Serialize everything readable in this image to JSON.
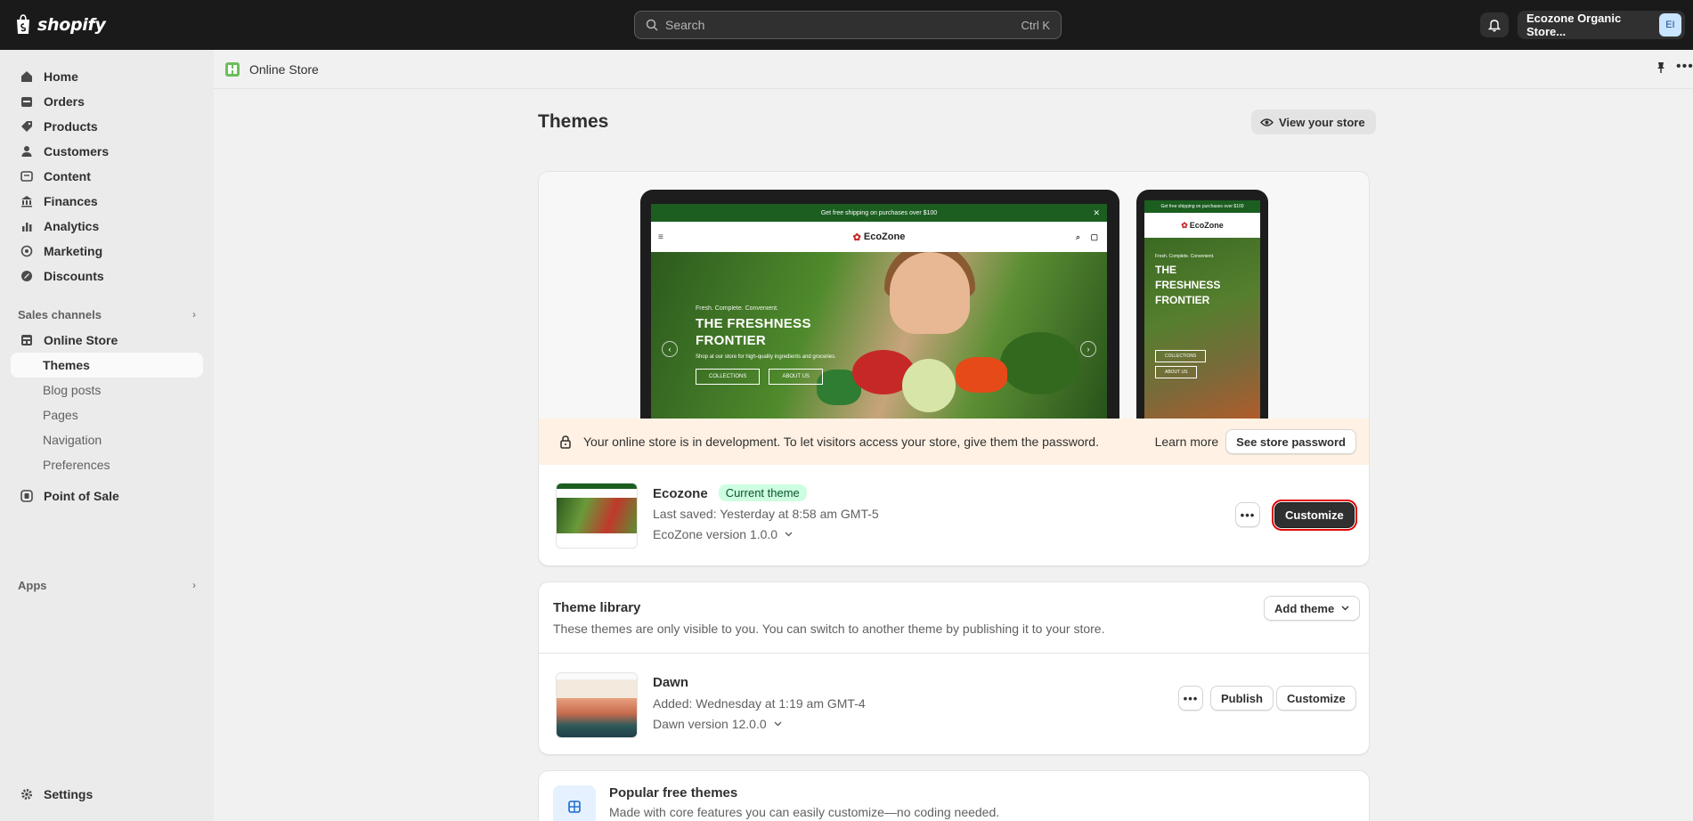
{
  "topbar": {
    "brand": "shopify",
    "search_placeholder": "Search",
    "search_shortcut": "Ctrl K",
    "store_name": "Ecozone Organic Store...",
    "store_initials": "EI"
  },
  "sidebar": {
    "items": [
      {
        "label": "Home",
        "icon": "home-icon"
      },
      {
        "label": "Orders",
        "icon": "orders-icon"
      },
      {
        "label": "Products",
        "icon": "tag-icon"
      },
      {
        "label": "Customers",
        "icon": "person-icon"
      },
      {
        "label": "Content",
        "icon": "content-icon"
      },
      {
        "label": "Finances",
        "icon": "bank-icon"
      },
      {
        "label": "Analytics",
        "icon": "chart-icon"
      },
      {
        "label": "Marketing",
        "icon": "target-icon"
      },
      {
        "label": "Discounts",
        "icon": "discount-icon"
      }
    ],
    "sales_channels_label": "Sales channels",
    "online_store_label": "Online Store",
    "online_store_sub": [
      "Themes",
      "Blog posts",
      "Pages",
      "Navigation",
      "Preferences"
    ],
    "pos_label": "Point of Sale",
    "apps_label": "Apps",
    "settings_label": "Settings"
  },
  "header": {
    "section": "Online Store"
  },
  "page": {
    "title": "Themes",
    "view_store": "View your store"
  },
  "preview": {
    "promo": "Get free shipping on purchases over $100",
    "shop_name": "EcoZone",
    "kicker": "Fresh. Complete. Convenient.",
    "headline_1": "THE FRESHNESS",
    "headline_2": "FRONTIER",
    "sub": "Shop at our store for high-quality ingredients and groceries.",
    "btn_1": "COLLECTIONS",
    "btn_2": "ABOUT US",
    "phone_headline_1": "THE",
    "phone_headline_2": "FRESHNESS",
    "phone_headline_3": "FRONTIER"
  },
  "dev_banner": {
    "message": "Your online store is in development. To let visitors access your store, give them the password.",
    "learn_more": "Learn more",
    "button": "See store password"
  },
  "current_theme": {
    "name": "Ecozone",
    "badge": "Current theme",
    "saved": "Last saved: Yesterday at 8:58 am GMT-5",
    "version": "EcoZone version 1.0.0",
    "customize": "Customize"
  },
  "library": {
    "title": "Theme library",
    "subtitle": "These themes are only visible to you. You can switch to another theme by publishing it to your store.",
    "add_theme": "Add theme",
    "themes": [
      {
        "name": "Dawn",
        "added": "Added: Wednesday at 1:19 am GMT-4",
        "version": "Dawn version 12.0.0",
        "publish": "Publish",
        "customize": "Customize"
      }
    ]
  },
  "popular": {
    "title": "Popular free themes",
    "subtitle": "Made with core features you can easily customize—no coding needed."
  },
  "colors": {
    "topbar": "#1a1a1a",
    "accent_dark": "#303030",
    "badge_bg": "#cdfee1",
    "banner_bg": "#fff1e3",
    "highlight": "#e00000"
  }
}
